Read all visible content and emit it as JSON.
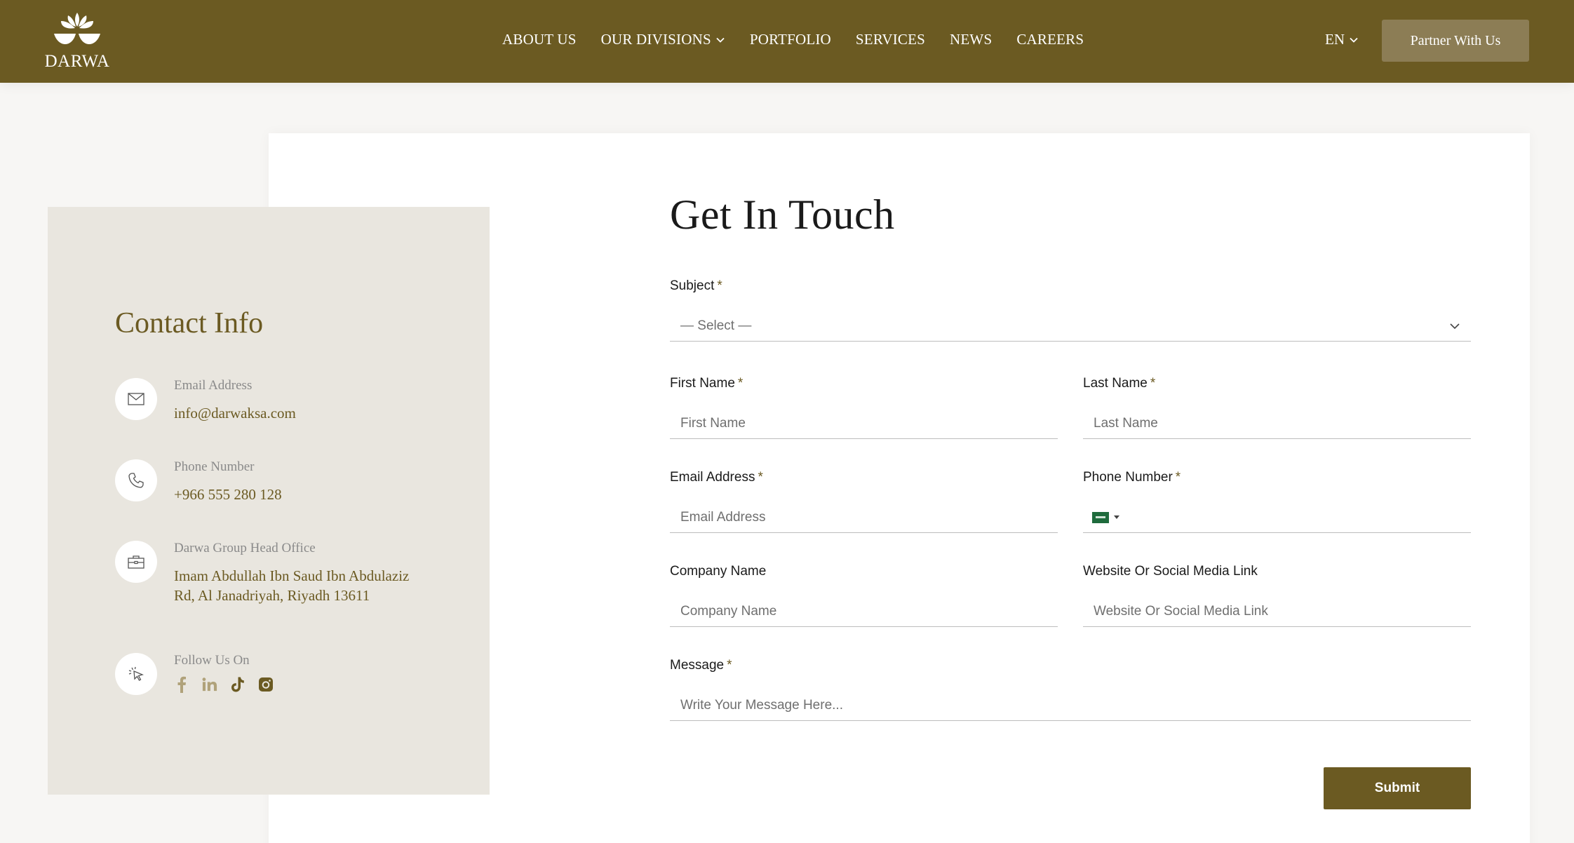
{
  "header": {
    "logo_text": "DARWA",
    "nav": [
      {
        "label": "ABOUT US"
      },
      {
        "label": "OUR DIVISIONS",
        "has_dropdown": true
      },
      {
        "label": "PORTFOLIO"
      },
      {
        "label": "SERVICES"
      },
      {
        "label": "NEWS"
      },
      {
        "label": "CAREERS"
      }
    ],
    "language": "EN",
    "partner_button": "Partner With Us"
  },
  "contact": {
    "title": "Contact Info",
    "email": {
      "label": "Email Address",
      "value": "info@darwaksa.com",
      "icon": "envelope-icon"
    },
    "phone": {
      "label": "Phone Number",
      "value": "+966 555 280 128",
      "icon": "phone-icon"
    },
    "office": {
      "label": "Darwa Group Head Office",
      "value": "Imam Abdullah Ibn Saud Ibn Abdulaziz Rd, Al Janadriyah, Riyadh 13611",
      "icon": "briefcase-icon"
    },
    "follow": {
      "label": "Follow Us On",
      "icon": "pointer-icon",
      "socials": [
        "facebook-icon",
        "linkedin-icon",
        "tiktok-icon",
        "instagram-icon"
      ]
    }
  },
  "form": {
    "title": "Get In Touch",
    "required_mark": "*",
    "subject": {
      "label": "Subject",
      "value": "— Select —"
    },
    "first_name": {
      "label": "First Name",
      "placeholder": "First Name"
    },
    "last_name": {
      "label": "Last Name",
      "placeholder": "Last Name"
    },
    "email": {
      "label": "Email Address",
      "placeholder": "Email Address"
    },
    "phone": {
      "label": "Phone Number",
      "country": "SA"
    },
    "company": {
      "label": "Company Name",
      "placeholder": "Company Name"
    },
    "website": {
      "label": "Website Or Social Media Link",
      "placeholder": "Website Or Social Media Link"
    },
    "message": {
      "label": "Message",
      "placeholder": "Write Your Message Here..."
    },
    "submit": "Submit"
  },
  "colors": {
    "brand": "#6b5a22",
    "partner_button": "#8c7d55",
    "contact_panel": "#e9e6df"
  }
}
